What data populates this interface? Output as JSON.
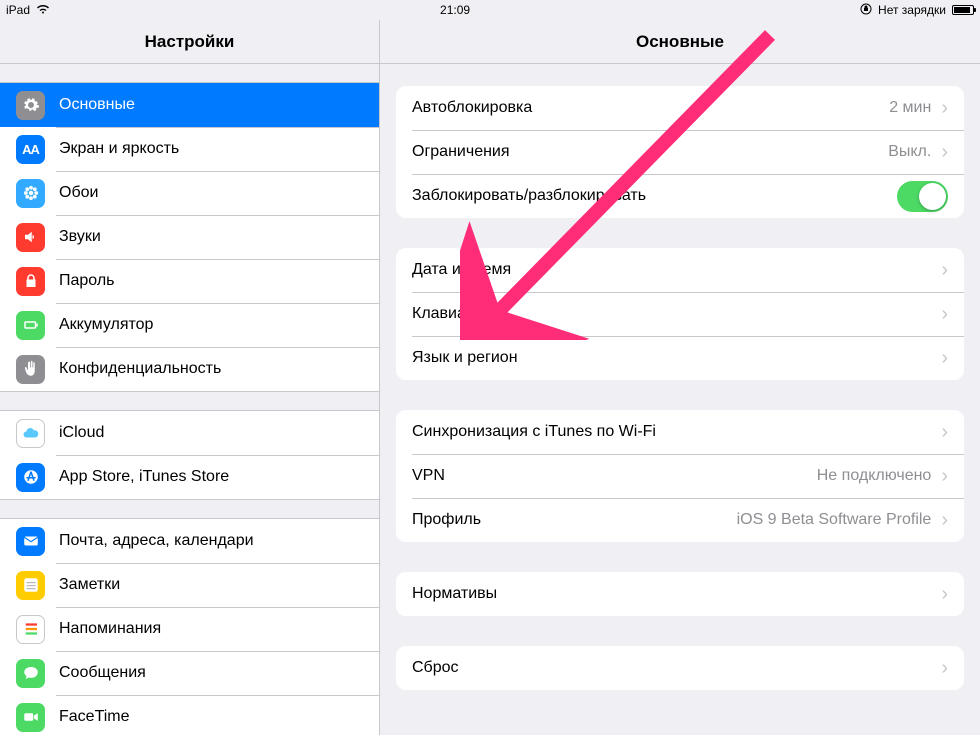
{
  "statusbar": {
    "device": "iPad",
    "time": "21:09",
    "charging_text": "Нет зарядки"
  },
  "header": {
    "left_title": "Настройки",
    "right_title": "Основные"
  },
  "sidebar": {
    "groups": [
      {
        "items": [
          {
            "key": "general",
            "label": "Основные",
            "icon": "gear",
            "bg": "bg-gray",
            "selected": true
          },
          {
            "key": "display",
            "label": "Экран и яркость",
            "icon": "aa",
            "bg": "bg-blue"
          },
          {
            "key": "wallpaper",
            "label": "Обои",
            "icon": "flower",
            "bg": "bg-cyan"
          },
          {
            "key": "sounds",
            "label": "Звуки",
            "icon": "speaker",
            "bg": "bg-red"
          },
          {
            "key": "passcode",
            "label": "Пароль",
            "icon": "lock",
            "bg": "bg-red"
          },
          {
            "key": "battery",
            "label": "Аккумулятор",
            "icon": "batt",
            "bg": "bg-green"
          },
          {
            "key": "privacy",
            "label": "Конфиденциальность",
            "icon": "hand",
            "bg": "bg-gray"
          }
        ]
      },
      {
        "items": [
          {
            "key": "icloud",
            "label": "iCloud",
            "icon": "cloud",
            "bg": "bg-white"
          },
          {
            "key": "appstore",
            "label": "App Store, iTunes Store",
            "icon": "appstore",
            "bg": "bg-blue"
          }
        ]
      },
      {
        "items": [
          {
            "key": "mail",
            "label": "Почта, адреса, календари",
            "icon": "mail",
            "bg": "bg-blue"
          },
          {
            "key": "notes",
            "label": "Заметки",
            "icon": "notes",
            "bg": "bg-yellow"
          },
          {
            "key": "reminders",
            "label": "Напоминания",
            "icon": "reminders",
            "bg": "bg-white"
          },
          {
            "key": "messages",
            "label": "Сообщения",
            "icon": "message",
            "bg": "bg-green"
          },
          {
            "key": "facetime",
            "label": "FaceTime",
            "icon": "facetime",
            "bg": "bg-green"
          }
        ]
      }
    ]
  },
  "detail": {
    "groups": [
      {
        "rows": [
          {
            "key": "autolock",
            "label": "Автоблокировка",
            "value": "2 мин",
            "chevron": true
          },
          {
            "key": "restrictions",
            "label": "Ограничения",
            "value": "Выкл.",
            "chevron": true
          },
          {
            "key": "lockunlock",
            "label": "Заблокировать/разблокировать",
            "toggle": true,
            "toggle_on": true
          }
        ]
      },
      {
        "rows": [
          {
            "key": "datetime",
            "label": "Дата и время",
            "chevron": true
          },
          {
            "key": "keyboard",
            "label": "Клавиатура",
            "chevron": true
          },
          {
            "key": "language",
            "label": "Язык и регион",
            "chevron": true
          }
        ]
      },
      {
        "rows": [
          {
            "key": "itunessync",
            "label": "Синхронизация с iTunes по Wi-Fi",
            "chevron": true
          },
          {
            "key": "vpn",
            "label": "VPN",
            "value": "Не подключено",
            "chevron": true
          },
          {
            "key": "profile",
            "label": "Профиль",
            "value": "iOS 9 Beta Software Profile",
            "chevron": true
          }
        ]
      },
      {
        "rows": [
          {
            "key": "regulatory",
            "label": "Нормативы",
            "chevron": true
          }
        ]
      },
      {
        "rows": [
          {
            "key": "reset",
            "label": "Сброс",
            "chevron": true
          }
        ]
      }
    ]
  }
}
